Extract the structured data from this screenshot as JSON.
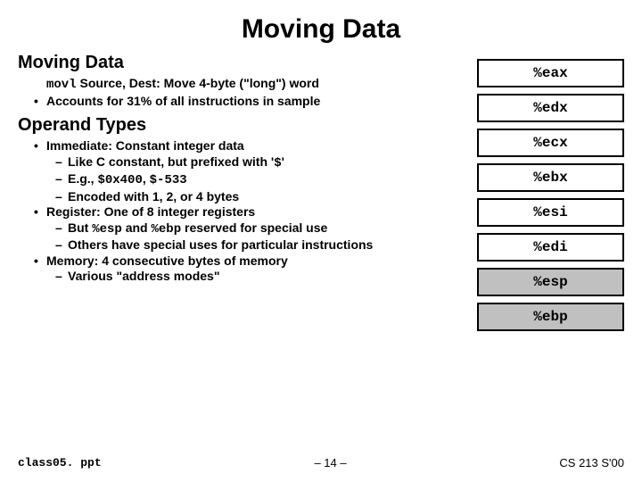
{
  "title": "Moving Data",
  "left": {
    "h_moving": "Moving Data",
    "movl_code": "movl",
    "movl_rest": " Source, Dest: Move 4-byte (\"long\") word",
    "accounts": "Accounts for 31% of all instructions in sample",
    "h_operand": "Operand Types",
    "immediate": "Immediate: Constant integer data",
    "like_c_pre": "Like C constant, but prefixed with '",
    "like_c_dollar": "$",
    "like_c_post": "'",
    "eg_pre": "E.g., ",
    "eg_a": "$0x400",
    "eg_mid": ", ",
    "eg_b": "$-533",
    "encoded": "Encoded with 1, 2, or 4 bytes",
    "register": "Register: One of 8 integer registers",
    "but_pre": "But ",
    "but_esp": "%esp",
    "but_mid": " and ",
    "but_ebp": "%ebp",
    "but_post": " reserved for special use",
    "others": "Others have special uses for particular instructions",
    "memory": "Memory: 4 consecutive bytes of memory",
    "various": "Various \"address modes\""
  },
  "registers": {
    "r0": "%eax",
    "r1": "%edx",
    "r2": "%ecx",
    "r3": "%ebx",
    "r4": "%esi",
    "r5": "%edi",
    "r6": "%esp",
    "r7": "%ebp"
  },
  "footer": {
    "file": "class05. ppt",
    "page": "– 14 –",
    "course": "CS 213 S'00"
  }
}
